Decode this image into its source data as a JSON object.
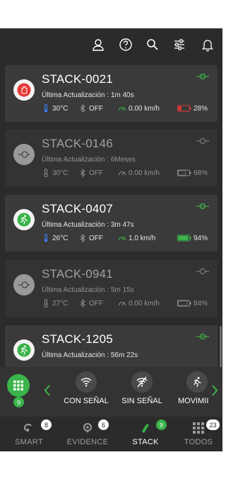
{
  "header": {
    "icons": [
      "user-icon",
      "help-icon",
      "search-icon",
      "filter-settings-icon",
      "bell-icon"
    ]
  },
  "devices": [
    {
      "name": "STACK-0021",
      "update_label": "Última Actualización :",
      "update_value": "1m 40s",
      "temperature": "30°C",
      "bluetooth": "OFF",
      "speed": "0.00 km/h",
      "battery": "28%",
      "battery_level": 0.28,
      "status_icon": "hand-stop-icon",
      "status_color": "#e53935",
      "active": true
    },
    {
      "name": "STACK-0146",
      "update_label": "Última Actualización :",
      "update_value": "6Meses",
      "temperature": "30°C",
      "bluetooth": "OFF",
      "speed": "0.00 km/h",
      "battery": "68%",
      "battery_level": 0.68,
      "status_icon": "plug-icon",
      "status_color": "#8a8a8a",
      "active": false
    },
    {
      "name": "STACK-0407",
      "update_label": "Última Actualización :",
      "update_value": "3m 47s",
      "temperature": "26°C",
      "bluetooth": "OFF",
      "speed": "1.0 km/h",
      "battery": "94%",
      "battery_level": 0.94,
      "status_icon": "running-person-icon",
      "status_color": "#3bb44a",
      "active": true
    },
    {
      "name": "STACK-0941",
      "update_label": "Última Actualización :",
      "update_value": "5m 15s",
      "temperature": "27°C",
      "bluetooth": "OFF",
      "speed": "0.00 km/h",
      "battery": "84%",
      "battery_level": 0.84,
      "status_icon": "plug-icon",
      "status_color": "#8a8a8a",
      "active": false
    },
    {
      "name": "STACK-1205",
      "update_label": "Última Actualización :",
      "update_value": "56m 22s",
      "status_icon": "running-person-icon",
      "status_color": "#3bb44a",
      "active": true
    }
  ],
  "filters": {
    "grid_badge": "9",
    "items": [
      {
        "label": "CON SEÑAL",
        "icon": "wifi-signal-icon"
      },
      {
        "label": "SIN SEÑAL",
        "icon": "no-signal-icon"
      },
      {
        "label": "MOVIMII",
        "icon": "running-person-icon"
      }
    ]
  },
  "nav": [
    {
      "label": "SMART",
      "badge": "8",
      "icon": "smart-icon"
    },
    {
      "label": "EVIDENCE",
      "badge": "6",
      "icon": "evidence-icon"
    },
    {
      "label": "STACK",
      "badge": "9",
      "icon": "stack-icon",
      "active": true
    },
    {
      "label": "TODOS",
      "badge": "23",
      "icon": "grid-icon"
    }
  ],
  "colors": {
    "accent_green": "#3bb44a",
    "temp_blue": "#3d7ef5",
    "battery_low_red": "#e53935",
    "background": "#2b2b2b",
    "card": "#3a3a3a"
  }
}
